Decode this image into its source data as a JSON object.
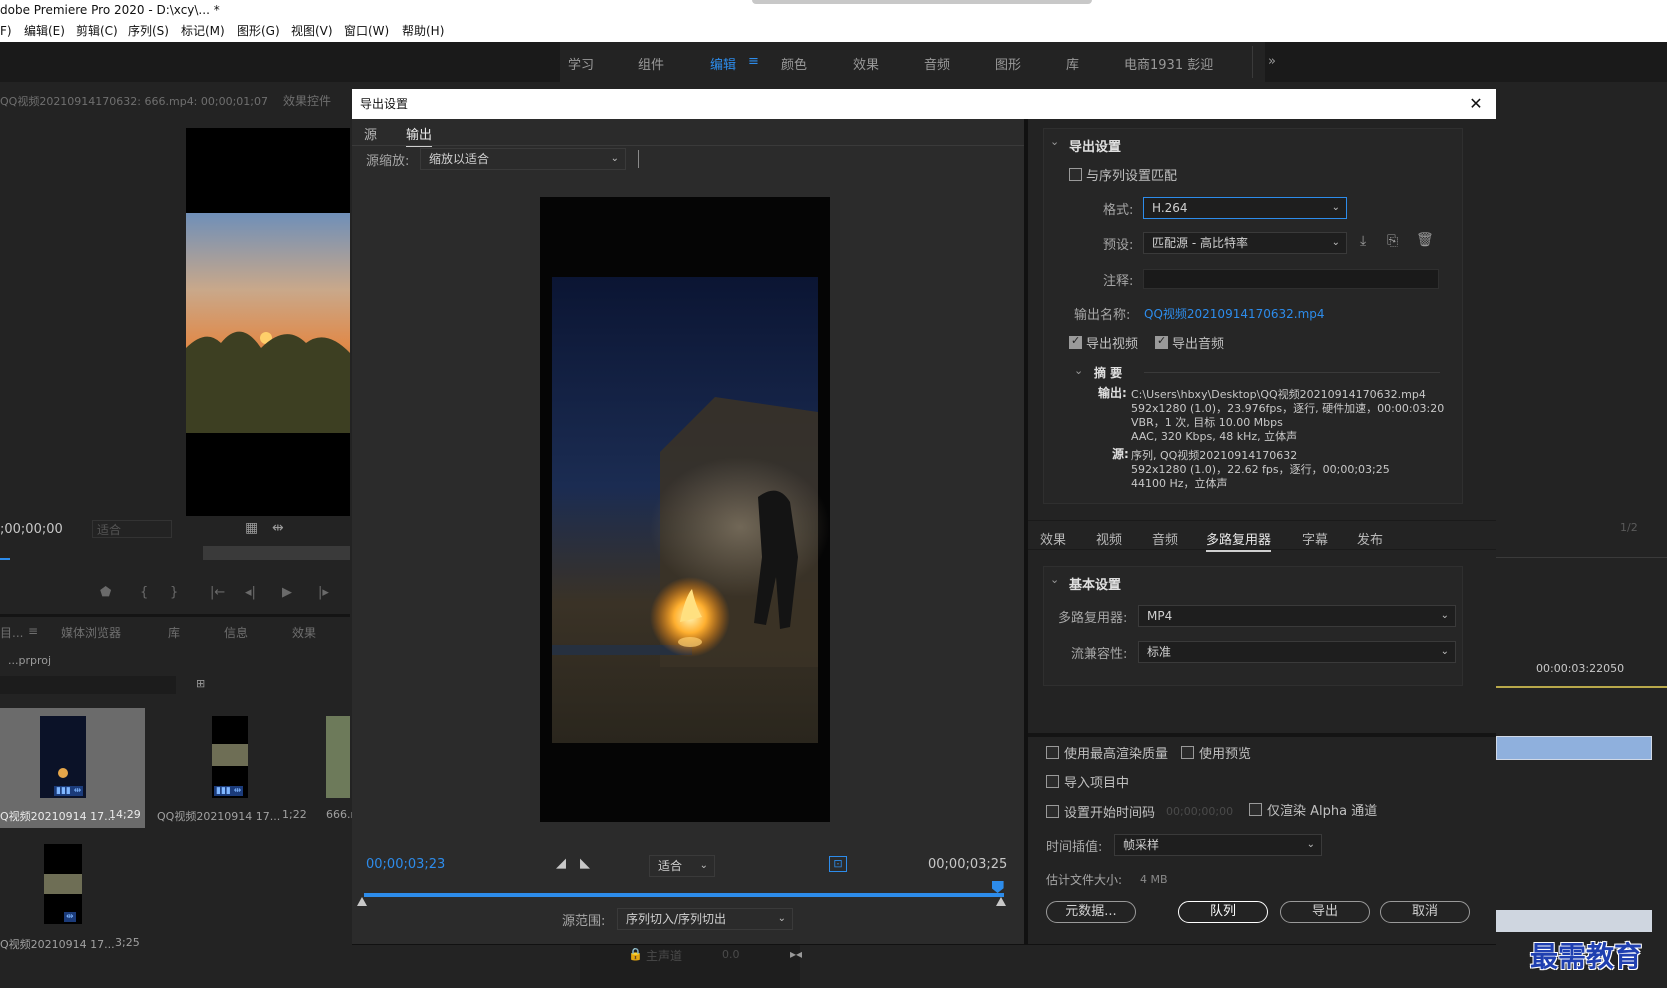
{
  "app": {
    "title": "dobe Premiere Pro 2020 - D:\\xcy\\... *"
  },
  "menu": [
    "F)",
    "编辑(E)",
    "剪辑(C)",
    "序列(S)",
    "标记(M)",
    "图形(G)",
    "视图(V)",
    "窗口(W)",
    "帮助(H)"
  ],
  "workspaces": [
    "学习",
    "组件",
    "编辑",
    "颜色",
    "效果",
    "音频",
    "图形",
    "库",
    "电商1931 彭迎",
    "»"
  ],
  "workspace_active": "编辑",
  "source_panel": {
    "tab_source": "QQ视频20210914170632: 666.mp4: 00;00;01;07",
    "tab_effects": "效果控件",
    "timecode": ";00;00;00",
    "fit": "适合"
  },
  "project_panel": {
    "tabs": [
      "目...",
      "媒体浏览器",
      "库",
      "信息",
      "效果"
    ],
    "project_name": "...prproj",
    "items": [
      {
        "name": "Q视频20210914 17...",
        "duration": "14;29"
      },
      {
        "name": "QQ视频20210914 17...",
        "duration": "1;22"
      },
      {
        "name": "666.r",
        "duration": ""
      },
      {
        "name": "Q视频20210914 17...",
        "duration": "3;25"
      }
    ]
  },
  "timeline_panel": {
    "page": "1/2",
    "time": "00:00:03:22050",
    "track": "主声道",
    "track_val": "0.0"
  },
  "dialog": {
    "title": "导出设置",
    "close": "✕",
    "left_tabs": [
      "源",
      "输出"
    ],
    "left_tab_active": "输出",
    "source_scaling_label": "源缩放:",
    "source_scaling_value": "缩放以适合",
    "timecode_current": "00;00;03;23",
    "timecode_end": "00;00;03;25",
    "fit_value": "适合",
    "source_range_label": "源范围:",
    "source_range_value": "序列切入/序列切出",
    "playhead_fraction": 0.99,
    "export_settings": {
      "header": "导出设置",
      "match_sequence": "与序列设置匹配",
      "format_label": "格式:",
      "format_value": "H.264",
      "preset_label": "预设:",
      "preset_value": "匹配源 - 高比特率",
      "comment_label": "注释:",
      "comment_value": "",
      "output_name_label": "输出名称:",
      "output_name_value": "QQ视频20210914170632.mp4",
      "export_video": "导出视频",
      "export_audio": "导出音频",
      "summary_header": "摘 要",
      "output_label": "输出:",
      "output_lines": [
        "C:\\Users\\hbxy\\Desktop\\QQ视频20210914170632.mp4",
        "592x1280 (1.0)，23.976fps，逐行, 硬件加速，00:00:03:20",
        "VBR，1 次, 目标 10.00 Mbps",
        "AAC, 320 Kbps, 48  kHz, 立体声"
      ],
      "source_label": "源:",
      "source_lines": [
        "序列, QQ视频20210914170632",
        "592x1280 (1.0)，22.62 fps，逐行，00;00;03;25",
        "44100 Hz，立体声"
      ]
    },
    "right_tabs": [
      "效果",
      "视频",
      "音频",
      "多路复用器",
      "字幕",
      "发布"
    ],
    "right_tab_active": "多路复用器",
    "basic": {
      "header": "基本设置",
      "mux_label": "多路复用器:",
      "mux_value": "MP4",
      "stream_label": "流兼容性:",
      "stream_value": "标准"
    },
    "options": {
      "max_quality": "使用最高渲染质量",
      "use_previews": "使用预览",
      "import_project": "导入项目中",
      "set_timecode": "设置开始时间码",
      "timecode_value": "00;00;00;00",
      "alpha_only": "仅渲染 Alpha 通道",
      "interp_label": "时间插值:",
      "interp_value": "帧采样",
      "filesize_label": "估计文件大小:",
      "filesize_value": "4 MB"
    },
    "buttons": {
      "metadata": "元数据...",
      "queue": "队列",
      "export": "导出",
      "cancel": "取消"
    }
  },
  "watermark": "最需教育"
}
